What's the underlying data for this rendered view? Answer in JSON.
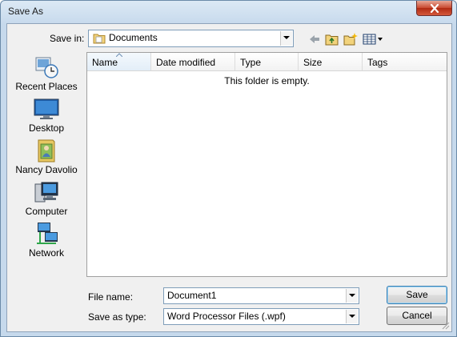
{
  "window": {
    "title": "Save As"
  },
  "save_in": {
    "label": "Save in:",
    "value": "Documents"
  },
  "places": [
    {
      "label": "Recent Places",
      "icon": "recent-places-icon"
    },
    {
      "label": "Desktop",
      "icon": "desktop-icon"
    },
    {
      "label": "Nancy Davolio",
      "icon": "user-folder-icon"
    },
    {
      "label": "Computer",
      "icon": "computer-icon"
    },
    {
      "label": "Network",
      "icon": "network-icon"
    }
  ],
  "file_list": {
    "columns": [
      "Name",
      "Date modified",
      "Type",
      "Size",
      "Tags"
    ],
    "sorted_column": "Name",
    "empty_message": "This folder is empty."
  },
  "file_name": {
    "label": "File name:",
    "value": "Document1"
  },
  "save_as_type": {
    "label": "Save as type:",
    "value": "Word Processor Files (.wpf)"
  },
  "buttons": {
    "save": "Save",
    "cancel": "Cancel"
  },
  "colors": {
    "title_close": "#c8482f",
    "list_bg": "#ffffff",
    "dialog_bg": "#f0f0f0"
  }
}
